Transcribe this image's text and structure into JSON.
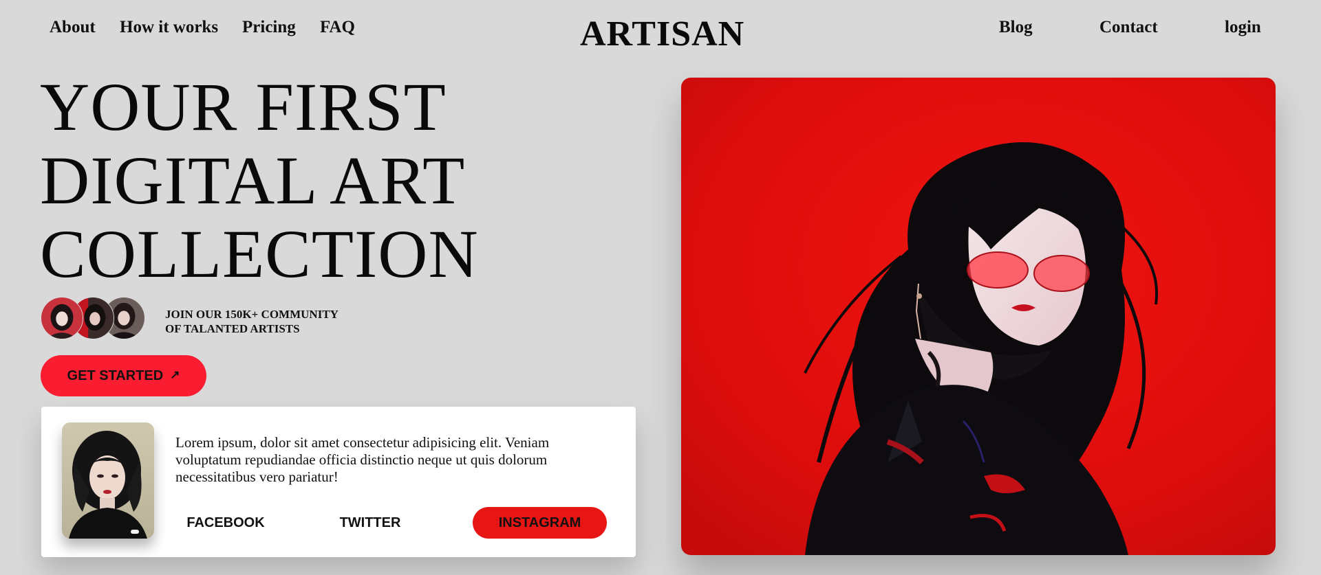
{
  "nav": {
    "left": [
      {
        "label": "About"
      },
      {
        "label": "How it works"
      },
      {
        "label": "Pricing"
      },
      {
        "label": "FAQ"
      }
    ],
    "brand": "ARTISAN",
    "right": [
      {
        "label": "Blog"
      },
      {
        "label": "Contact"
      },
      {
        "label": "login"
      }
    ]
  },
  "hero": {
    "title_lines": [
      "YOUR FIRST",
      "DIGITAL ART",
      "COLLECTION"
    ],
    "community_lines": [
      "JOIN OUR 150K+ COMMUNITY",
      "OF TALANTED ARTISTS"
    ],
    "cta_label": "GET STARTED",
    "cta_icon": "arrow-up-right-icon"
  },
  "card": {
    "text": "Lorem ipsum, dolor sit amet consectetur adipisicing elit. Veniam voluptatum repudiandae officia distinctio neque ut quis dolorum necessitatibus vero pariatur!",
    "social": [
      "FACEBOOK",
      "TWITTER",
      "INSTAGRAM"
    ]
  },
  "colors": {
    "background": "#d9d9d9",
    "accent": "#fa1c30",
    "instagram": "#e81515",
    "card": "#ffffff"
  }
}
